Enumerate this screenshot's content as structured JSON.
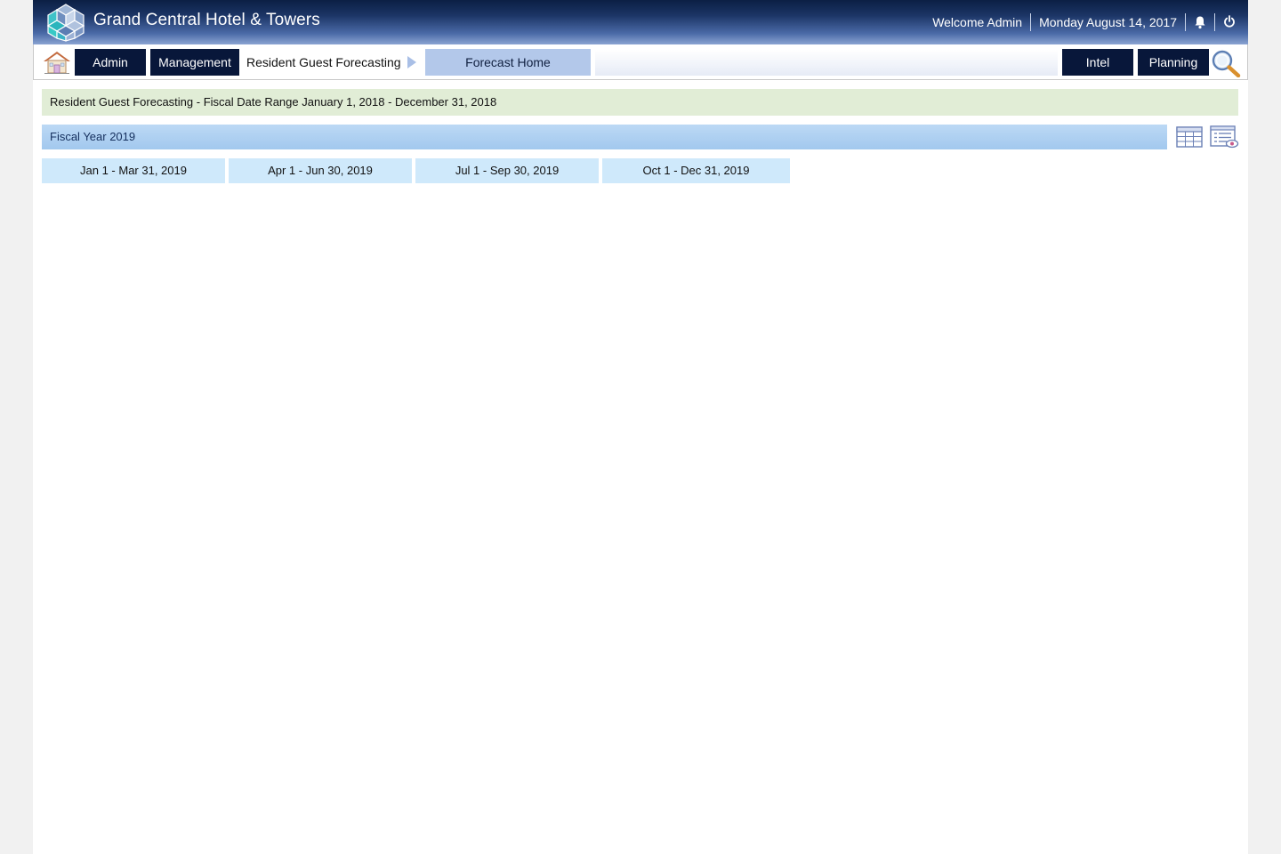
{
  "header": {
    "brand": "Grand Central Hotel & Towers",
    "welcome": "Welcome Admin",
    "date": "Monday August 14, 2017",
    "icons": [
      "bell-icon",
      "power-icon"
    ],
    "gradient_top": "#0b1f44",
    "gradient_bottom": "#8aa3d2"
  },
  "nav": {
    "admin_label": "Admin",
    "management_label": "Management",
    "breadcrumb_label": "Resident Guest Forecasting",
    "forecast_home_label": "Forecast Home",
    "search_value": "",
    "intel_label": "Intel",
    "planning_label": "Planning",
    "button_color": "#08173a",
    "active_color": "#b3c8ea"
  },
  "content": {
    "range_title": "Resident Guest Forecasting - Fiscal Date Range January 1, 2018 - December 31, 2018",
    "fiscal_year": "Fiscal Year 2019",
    "quarters": [
      "Jan 1 - Mar 31, 2019",
      "Apr 1 - Jun 30, 2019",
      "Jul 1 - Sep 30, 2019",
      "Oct 1 - Dec 31, 2019"
    ],
    "tool_icons": [
      "table-grid-icon",
      "list-view-icon"
    ],
    "range_bar_color": "#e1edd6",
    "fy_bar_color": "#a2c8ee",
    "quarter_color": "#cfe9fb"
  }
}
